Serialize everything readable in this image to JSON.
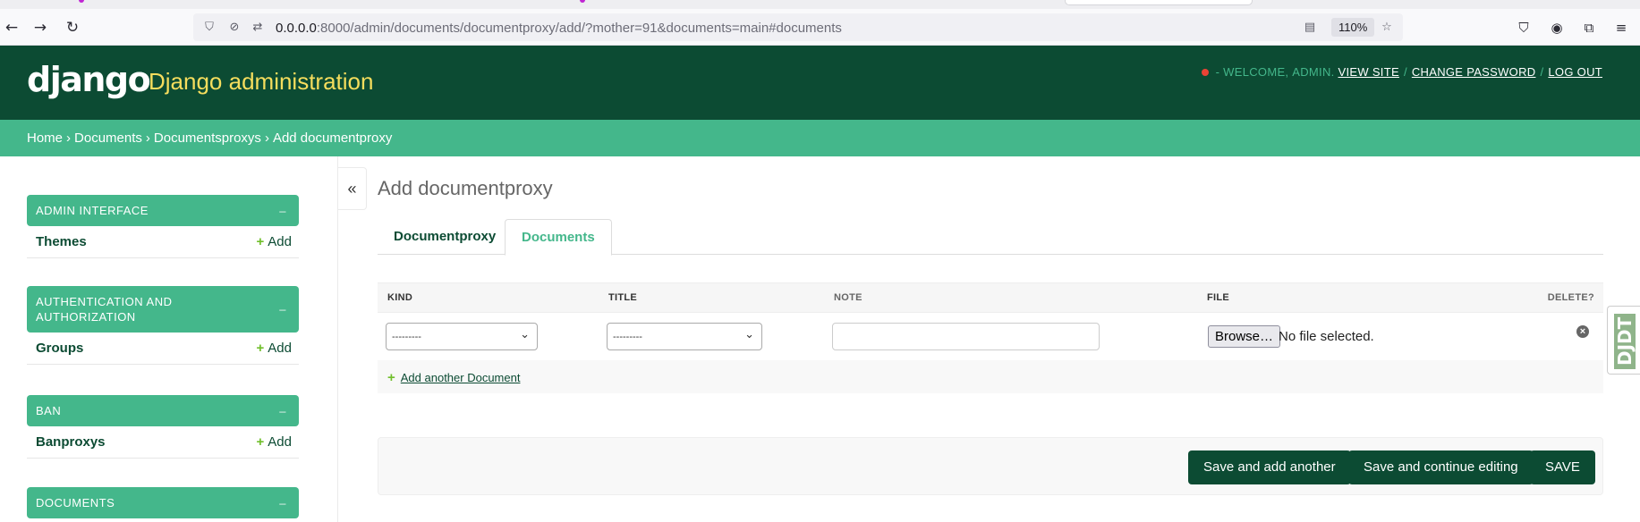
{
  "browser": {
    "url_host": "0.0.0.0",
    "url_rest": ":8000/admin/documents/documentproxy/add/?mother=91&documents=main#documents",
    "zoom": "110%",
    "icons": [
      "back-icon",
      "forward-icon",
      "reload-icon",
      "shield-icon",
      "no-tracking-icon",
      "permissions-icon",
      "reader-view-icon",
      "bookmark-star-icon",
      "pocket-icon",
      "account-icon",
      "extensions-icon",
      "menu-icon"
    ]
  },
  "header": {
    "logo": "django",
    "site_name": "Django administration",
    "welcome": "- Welcome,",
    "username": "admin.",
    "view_site": "View site",
    "change_password": "Change password",
    "log_out": "Log out",
    "sep": "/"
  },
  "breadcrumbs": {
    "items": [
      "Home",
      "Documents",
      "Documentsproxys"
    ],
    "current": "Add documentproxy",
    "arrow": "›"
  },
  "sidebar": {
    "toggle": "«",
    "collapse_glyph": "–",
    "add_label": "Add",
    "modules": [
      {
        "caption": "Admin interface",
        "models": [
          "Themes"
        ]
      },
      {
        "caption": "Authentication and Authorization",
        "models": [
          "Groups"
        ]
      },
      {
        "caption": "Ban",
        "models": [
          "Banproxys"
        ]
      },
      {
        "caption": "Documents",
        "models": []
      }
    ]
  },
  "content": {
    "title": "Add documentproxy",
    "tabs": [
      {
        "label": "Documentproxy",
        "active": false
      },
      {
        "label": "Documents",
        "active": true
      }
    ],
    "inline": {
      "columns": [
        "Kind",
        "Title",
        "Note",
        "File",
        "Delete?"
      ],
      "row": {
        "kind_value": "---------",
        "title_value": "---------",
        "note_value": "",
        "browse_label": "Browse…",
        "file_status": "No file selected."
      },
      "add_another": "Add another Document"
    },
    "submit": {
      "save_add_another": "Save and add another",
      "save_continue": "Save and continue editing",
      "save": "SAVE"
    }
  },
  "debug_toolbar": {
    "label": "DJDT"
  },
  "colors": {
    "header_bg": "#0c4b33",
    "accent": "#44b78b",
    "site_name": "#f5dd5d",
    "add_plus": "#70bf2b",
    "button_bg": "#0c4b33"
  }
}
